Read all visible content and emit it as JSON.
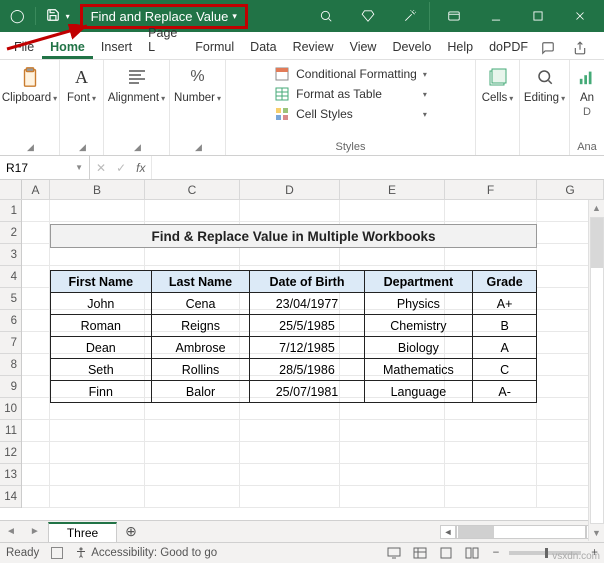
{
  "titlebar": {
    "workbook_title": "Find and Replace Value"
  },
  "tabs": {
    "file": "File",
    "home": "Home",
    "insert": "Insert",
    "page": "Page L",
    "formul": "Formul",
    "data": "Data",
    "review": "Review",
    "view": "View",
    "develo": "Develo",
    "help": "Help",
    "dopdf": "doPDF"
  },
  "ribbon": {
    "clipboard": {
      "label": "Clipboard"
    },
    "font": {
      "label": "Font"
    },
    "alignment": {
      "label": "Alignment"
    },
    "number": {
      "label": "Number"
    },
    "styles": {
      "label": "Styles",
      "cond": "Conditional Formatting",
      "table": "Format as Table",
      "cell": "Cell Styles"
    },
    "cells": {
      "label": "Cells"
    },
    "editing": {
      "label": "Editing"
    },
    "analyze": {
      "label": "An",
      "sub1": "D",
      "sub2": "Ana"
    }
  },
  "fbar": {
    "namebox": "R17",
    "formula": ""
  },
  "cols": {
    "a": "A",
    "b": "B",
    "c": "C",
    "d": "D",
    "e": "E",
    "f": "F",
    "g": "G"
  },
  "rows": [
    "1",
    "2",
    "3",
    "4",
    "5",
    "6",
    "7",
    "8",
    "9",
    "10",
    "11",
    "12",
    "13",
    "14"
  ],
  "sheet": {
    "title": "Find & Replace Value in Multiple Workbooks",
    "headers": {
      "c1": "First Name",
      "c2": "Last Name",
      "c3": "Date of Birth",
      "c4": "Department",
      "c5": "Grade"
    },
    "data": [
      {
        "c1": "John",
        "c2": "Cena",
        "c3": "23/04/1977",
        "c4": "Physics",
        "c5": "A+"
      },
      {
        "c1": "Roman",
        "c2": "Reigns",
        "c3": "25/5/1985",
        "c4": "Chemistry",
        "c5": "B"
      },
      {
        "c1": "Dean",
        "c2": "Ambrose",
        "c3": "7/12/1985",
        "c4": "Biology",
        "c5": "A"
      },
      {
        "c1": "Seth",
        "c2": "Rollins",
        "c3": "28/5/1986",
        "c4": "Mathematics",
        "c5": "C"
      },
      {
        "c1": "Finn",
        "c2": "Balor",
        "c3": "25/07/1981",
        "c4": "Language",
        "c5": "A-"
      }
    ]
  },
  "sheettab": {
    "name": "Three",
    "add": "⊕"
  },
  "status": {
    "ready": "Ready",
    "access": "Accessibility: Good to go",
    "zoom_minus": "−",
    "zoom_plus": "+"
  },
  "watermark": "vsxdn.com",
  "chart_data": {
    "type": "table",
    "title": "Find & Replace Value in Multiple Workbooks",
    "columns": [
      "First Name",
      "Last Name",
      "Date of Birth",
      "Department",
      "Grade"
    ],
    "rows": [
      [
        "John",
        "Cena",
        "23/04/1977",
        "Physics",
        "A+"
      ],
      [
        "Roman",
        "Reigns",
        "25/5/1985",
        "Chemistry",
        "B"
      ],
      [
        "Dean",
        "Ambrose",
        "7/12/1985",
        "Biology",
        "A"
      ],
      [
        "Seth",
        "Rollins",
        "28/5/1986",
        "Mathematics",
        "C"
      ],
      [
        "Finn",
        "Balor",
        "25/07/1981",
        "Language",
        "A-"
      ]
    ]
  }
}
